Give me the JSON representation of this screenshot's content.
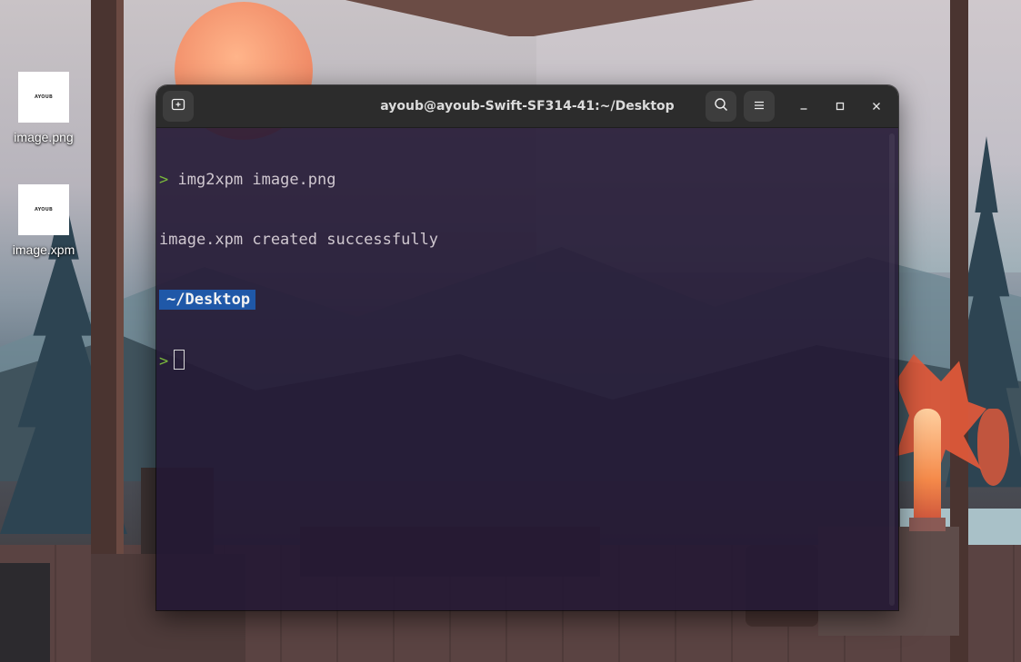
{
  "desktop": {
    "icons": [
      {
        "label": "image.png",
        "thumb_text": "AYOUB"
      },
      {
        "label": "image.xpm",
        "thumb_text": "AYOUB"
      }
    ]
  },
  "terminal": {
    "title": "ayoub@ayoub-Swift-SF314-41:~/Desktop",
    "buttons": {
      "new_tab_icon": "new-tab-icon",
      "search_icon": "search-icon",
      "menu_icon": "hamburger-menu-icon",
      "minimize_icon": "minimize-icon",
      "maximize_icon": "maximize-icon",
      "close_icon": "close-icon"
    },
    "lines": {
      "l1_prompt": ">",
      "l1_command": "img2xpm image.png",
      "l2_output": "image.xpm created successfully",
      "l3_path": "~/Desktop",
      "l4_prompt": ">"
    },
    "colors": {
      "prompt": "#7ab83c",
      "path_badge": "#1f58a8",
      "background": "#241834"
    }
  }
}
